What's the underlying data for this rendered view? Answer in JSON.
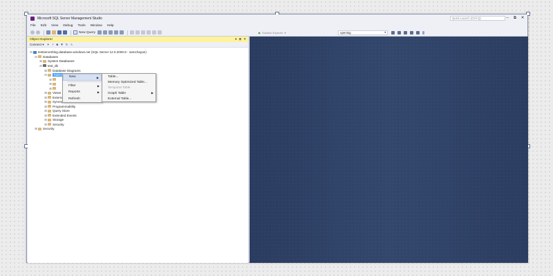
{
  "window": {
    "title": "Microsoft SQL Server Management Studio",
    "quick_launch_placeholder": "Quick Launch (Ctrl+Q)",
    "controls": [
      "–",
      "⧉",
      "✕"
    ]
  },
  "menu": [
    "File",
    "Edit",
    "View",
    "Debug",
    "Tools",
    "Window",
    "Help"
  ],
  "toolbar": {
    "new_query_label": "New Query",
    "debugger_select": "Solution Explorer",
    "search_value": "opening"
  },
  "object_explorer": {
    "title": "Object Explorer",
    "header_buttons": [
      "▾",
      "⊞",
      "✕"
    ],
    "connect_label": "Connect ▾",
    "tree": [
      {
        "label": "testserverblog.database.windows.net (SQL Server 12.0.2000.8 - samchayan)",
        "level": 0,
        "expander": "⊟",
        "icon": "server"
      },
      {
        "label": "Databases",
        "level": 1,
        "expander": "⊟",
        "icon": "folder"
      },
      {
        "label": "System Databases",
        "level": 2,
        "expander": "⊞",
        "icon": "folder"
      },
      {
        "label": "test_db",
        "level": 2,
        "expander": "⊟",
        "icon": "db"
      },
      {
        "label": "Database Diagrams",
        "level": 3,
        "expander": "⊞",
        "icon": "folder"
      },
      {
        "label": "Tables",
        "level": 3,
        "expander": "⊟",
        "icon": "folder",
        "selected": true
      },
      {
        "label": "",
        "level": 4,
        "expander": "⊞",
        "icon": "folder"
      },
      {
        "label": "",
        "level": 4,
        "expander": "⊞",
        "icon": "folder"
      },
      {
        "label": "",
        "level": 4,
        "expander": "⊞",
        "icon": "folder"
      },
      {
        "label": "Views",
        "level": 3,
        "expander": "⊞",
        "icon": "folder"
      },
      {
        "label": "External Resources",
        "level": 3,
        "expander": "⊞",
        "icon": "folder"
      },
      {
        "label": "Synonyms",
        "level": 3,
        "expander": "⊞",
        "icon": "folder"
      },
      {
        "label": "Programmability",
        "level": 3,
        "expander": "⊞",
        "icon": "folder"
      },
      {
        "label": "Query Store",
        "level": 3,
        "expander": "⊞",
        "icon": "folder"
      },
      {
        "label": "Extended Events",
        "level": 3,
        "expander": "⊞",
        "icon": "folder"
      },
      {
        "label": "Storage",
        "level": 3,
        "expander": "⊞",
        "icon": "folder"
      },
      {
        "label": "Security",
        "level": 3,
        "expander": "⊞",
        "icon": "folder"
      },
      {
        "label": "Security",
        "level": 1,
        "expander": "⊞",
        "icon": "folder"
      }
    ]
  },
  "context_menu": {
    "items": [
      {
        "label": "New",
        "submenu": true,
        "highlight": true
      },
      {
        "label": "Filter",
        "submenu": true
      },
      {
        "label": "Reports",
        "submenu": true
      },
      {
        "label": "Refresh",
        "submenu": false
      }
    ]
  },
  "submenu": {
    "items": [
      {
        "label": "Table...",
        "disabled": false,
        "submenu": false
      },
      {
        "label": "Memory Optimized Table...",
        "disabled": false,
        "submenu": false
      },
      {
        "label": "Temporal Table",
        "disabled": true,
        "submenu": false
      },
      {
        "label": "Graph Table",
        "disabled": false,
        "submenu": true
      },
      {
        "label": "External Table...",
        "disabled": false,
        "submenu": false
      }
    ]
  },
  "colors": {
    "document_area": "#2f4266",
    "oe_header": "#fff29d",
    "selection": "#3399ff"
  }
}
